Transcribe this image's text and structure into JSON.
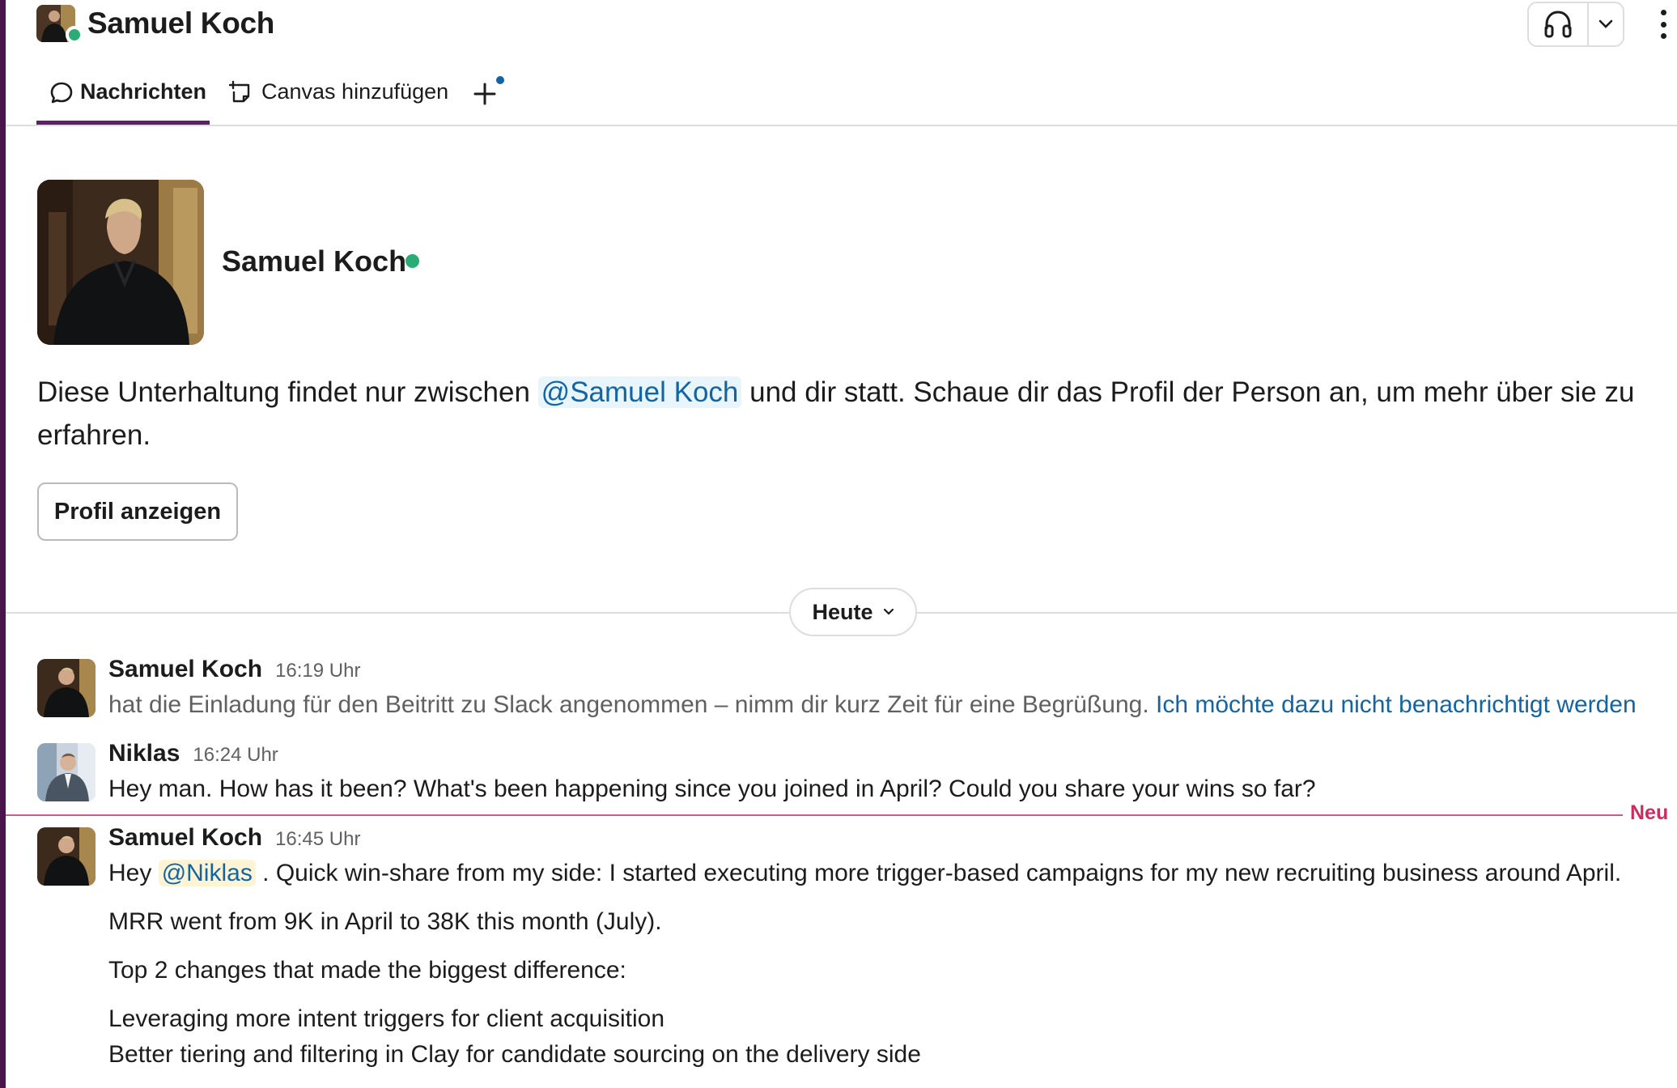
{
  "header": {
    "title": "Samuel Koch",
    "presence": "online",
    "huddle_icon": "headphones-icon",
    "huddle_menu_icon": "chevron-down-icon",
    "more_icon": "kebab-icon"
  },
  "tabs": [
    {
      "label": "Nachrichten",
      "icon": "message-icon",
      "active": true
    },
    {
      "label": "Canvas hinzufügen",
      "icon": "canvas-add-icon",
      "active": false
    }
  ],
  "add_tab_icon": "plus-icon",
  "intro": {
    "name": "Samuel Koch",
    "text_before": "Diese Unterhaltung findet nur zwischen ",
    "mention": "@Samuel Koch",
    "text_after": " und dir statt. Schaue dir das Profil der Person an, um mehr über sie zu erfahren.",
    "button": "Profil anzeigen"
  },
  "date_divider": "Heute",
  "new_divider": "Neu",
  "messages": [
    {
      "author": "Samuel Koch",
      "time": "16:19 Uhr",
      "text": "hat die Einladung für den Beitritt zu Slack angenommen – nimm dir kurz Zeit für eine Begrüßung. ",
      "link": "Ich möchte dazu nicht benachrichtigt werden"
    },
    {
      "author": "Niklas",
      "time": "16:24 Uhr",
      "text": "Hey man. How has it been? What's been happening since you joined in April? Could you share your wins so far?"
    },
    {
      "author": "Samuel Koch",
      "time": "16:45 Uhr",
      "greeting": "Hey ",
      "mention": "@Niklas",
      "line1_rest": " . Quick win-share from my side: I started executing more trigger-based campaigns for my new recruiting business around April.",
      "line2": "MRR went from 9K in April to 38K this month (July).",
      "line3": "Top 2 changes that made the biggest difference:",
      "line4": "Leveraging more intent triggers for client acquisition",
      "line5": "Better tiering and filtering in Clay for candidate sourcing on the delivery side"
    }
  ],
  "colors": {
    "sidebar": "#4a154b",
    "tab_active": "#611f69",
    "presence": "#2bac76",
    "link": "#1264a3",
    "new_marker": "#cc2d5e"
  }
}
